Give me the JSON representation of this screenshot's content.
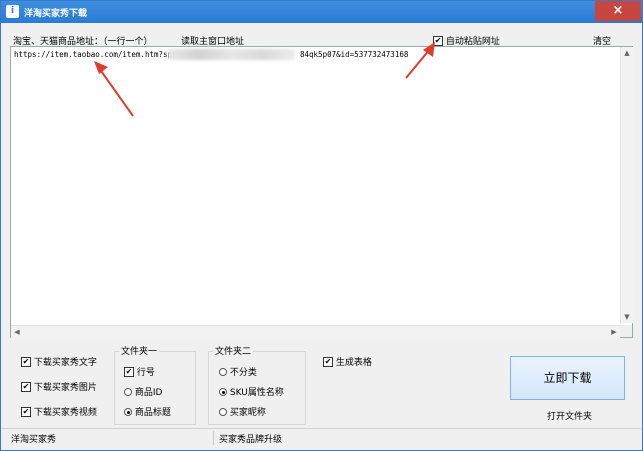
{
  "window": {
    "title": "洋淘买家秀下载",
    "icon": "app-icon",
    "close": "×"
  },
  "toprow": {
    "address_label": "淘宝、天猫商品地址：（一行一个）",
    "read_link": "读取主窗口地址",
    "auto_paste_label": "自动粘贴网址",
    "auto_paste_checked": true,
    "clear_link": "清空"
  },
  "input": {
    "url_prefix": "https://item.taobao.com/item.htm?spm=",
    "url_suffix": "84qk5p07&id=537732473168"
  },
  "download_options": [
    {
      "label": "下载买家秀文字",
      "checked": true
    },
    {
      "label": "下载买家秀图片",
      "checked": true
    },
    {
      "label": "下载买家秀视频",
      "checked": true
    }
  ],
  "folder1": {
    "title": "文件夹一",
    "row_option": {
      "label": "行号",
      "checked": true
    },
    "radios": [
      {
        "label": "商品ID",
        "selected": false
      },
      {
        "label": "商品标题",
        "selected": true
      }
    ]
  },
  "folder2": {
    "title": "文件夹二",
    "radios": [
      {
        "label": "不分类",
        "selected": false
      },
      {
        "label": "SKU属性名称",
        "selected": true
      },
      {
        "label": "买家昵称",
        "selected": false
      }
    ]
  },
  "generate_table": {
    "label": "生成表格",
    "checked": true
  },
  "actions": {
    "download_now": "立即下载",
    "open_folder": "打开文件夹"
  },
  "statusbar": {
    "left": "洋淘买家秀",
    "right": "买家秀品牌升级"
  },
  "colors": {
    "titlebar": "#2a7bd4",
    "close": "#c7463f",
    "arrow": "#e23b2e",
    "button_border": "#7eb4ea"
  }
}
